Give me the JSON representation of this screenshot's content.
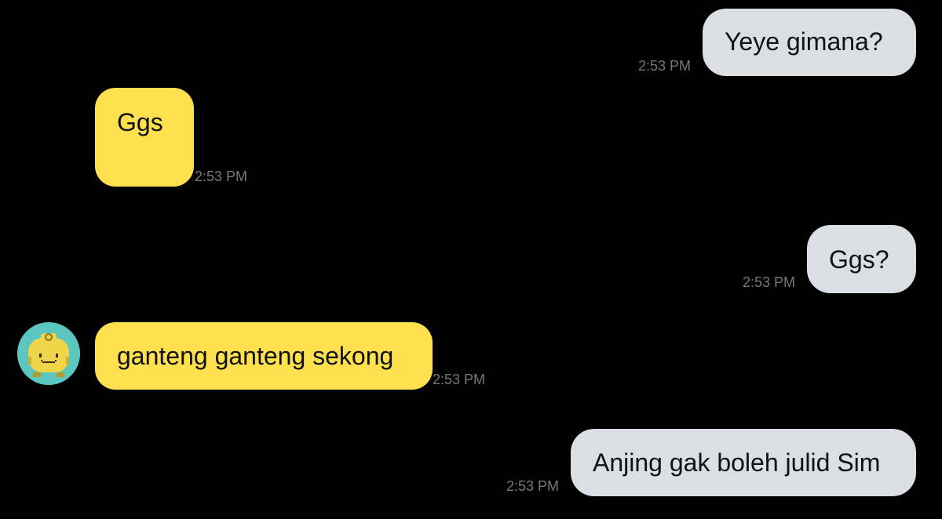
{
  "messages": [
    {
      "id": "m1",
      "direction": "outgoing",
      "text": "Yeye gimana?",
      "time": "2:53 PM"
    },
    {
      "id": "m2",
      "direction": "incoming",
      "text": "Ggs",
      "time": "2:53 PM"
    },
    {
      "id": "m3",
      "direction": "outgoing",
      "text": "Ggs?",
      "time": "2:53 PM"
    },
    {
      "id": "m4",
      "direction": "incoming",
      "text": "ganteng ganteng sekong",
      "time": "2:53 PM"
    },
    {
      "id": "m5",
      "direction": "outgoing",
      "text": "Anjing gak boleh julid Sim",
      "time": "2:53 PM"
    }
  ],
  "colors": {
    "background": "#000000",
    "outgoing_bubble": "#dcdee6",
    "incoming_bubble": "#ffe04f",
    "timestamp": "#777777",
    "avatar_bg": "#5bc7bf"
  },
  "avatar": {
    "icon": "yellow-pixel-character-avatar"
  }
}
